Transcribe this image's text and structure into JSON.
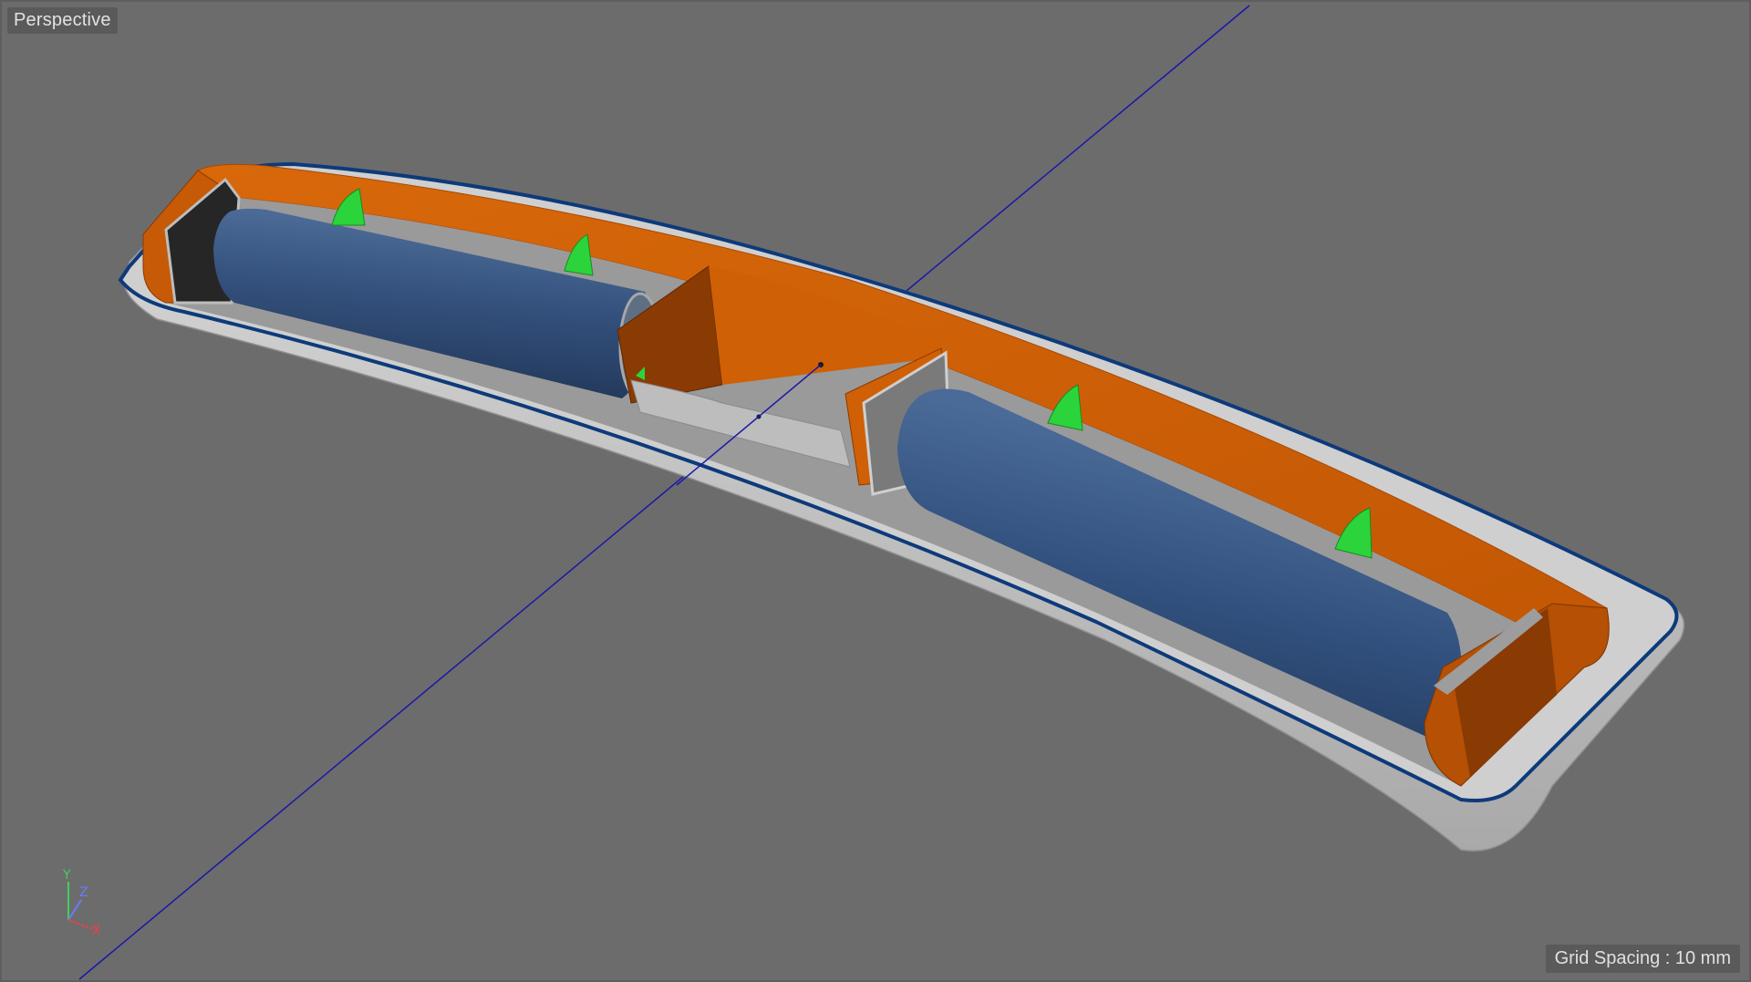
{
  "viewport": {
    "view_name": "Perspective",
    "grid_spacing_label": "Grid Spacing : 10 mm"
  },
  "axis_triad": {
    "y_label": "Y",
    "z_label": "Z",
    "x_label": "X",
    "y_color": "#3fd15a",
    "z_color": "#6a7cff",
    "x_color": "#ff3b3b"
  },
  "scene": {
    "background_color": "#6c6c6c",
    "shell_color": "#c9c9c9",
    "tray_color": "#cf5f06",
    "battery_color": "#2e4a72",
    "clip_color": "#2bd43b",
    "guide_line_color": "#1a18a8",
    "outline_color": "#0d3a7a"
  },
  "icons": {
    "axis": "axis-triad-icon"
  }
}
